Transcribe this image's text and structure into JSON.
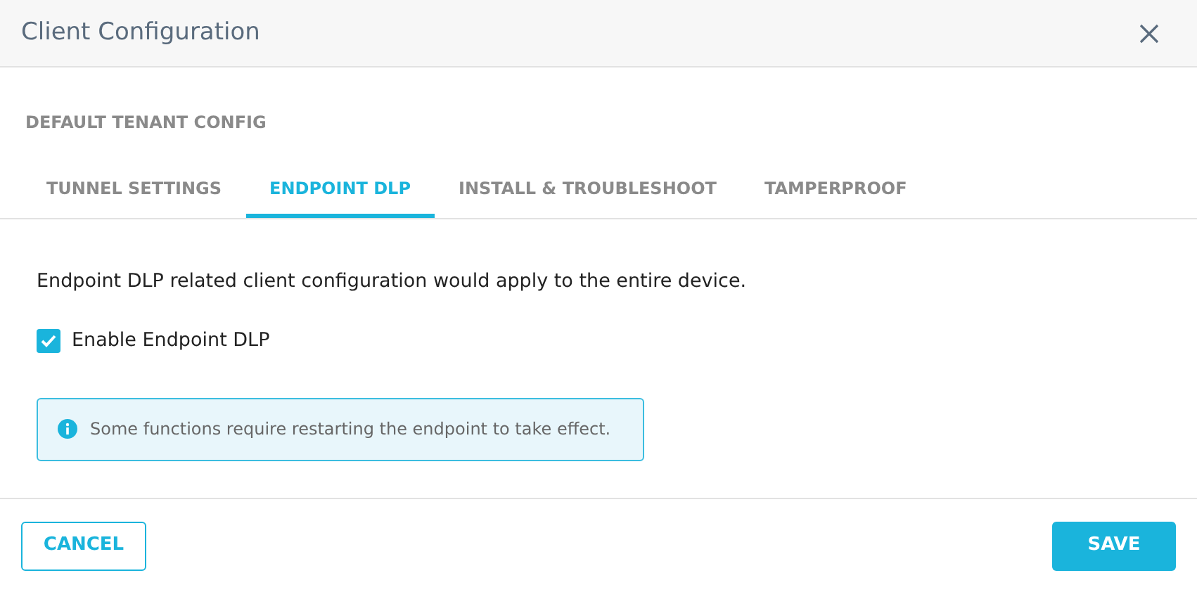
{
  "window": {
    "title": "Client Configuration"
  },
  "subtitle": "DEFAULT TENANT CONFIG",
  "tabs": [
    {
      "label": "TUNNEL SETTINGS",
      "selected": false
    },
    {
      "label": "ENDPOINT DLP",
      "selected": true
    },
    {
      "label": "INSTALL & TROUBLESHOOT",
      "selected": false
    },
    {
      "label": "TAMPERPROOF",
      "selected": false
    }
  ],
  "description": "Endpoint DLP related client configuration would apply to the entire device.",
  "enable_checkbox": {
    "label": "Enable Endpoint DLP",
    "checked": true
  },
  "info_message": "Some functions require restarting the endpoint to take effect.",
  "buttons": {
    "cancel": "CANCEL",
    "save": "SAVE"
  }
}
